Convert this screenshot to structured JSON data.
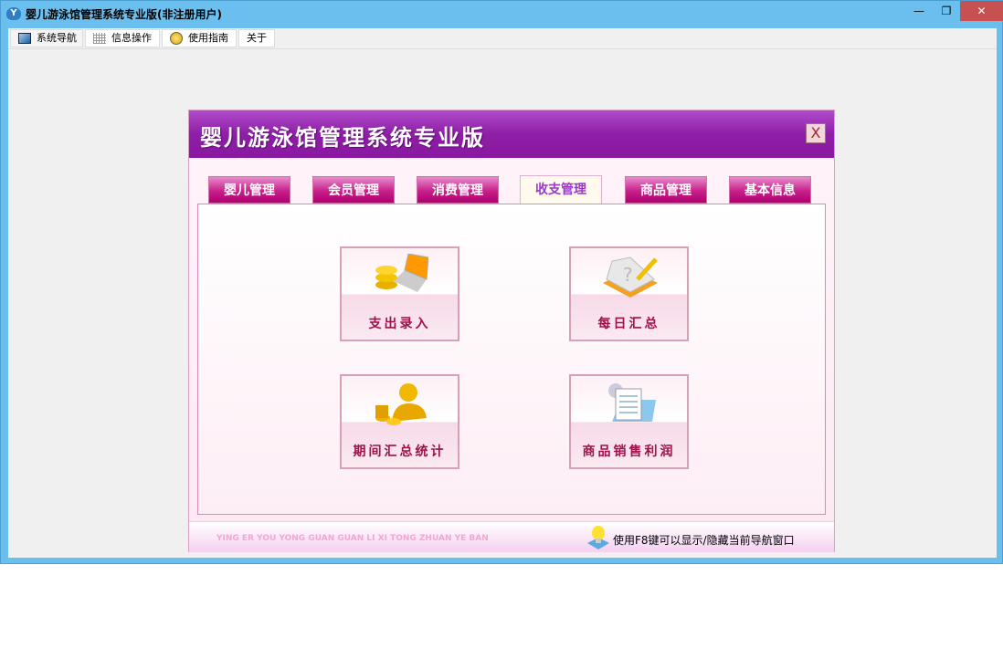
{
  "window": {
    "title": "婴儿游泳馆管理系统专业版(非注册用户)",
    "minimize": "—",
    "restore": "❐",
    "close": "✕"
  },
  "menu": [
    {
      "label": "系统导航",
      "icon": "monitor-icon"
    },
    {
      "label": "信息操作",
      "icon": "grid-icon"
    },
    {
      "label": "使用指南",
      "icon": "help-icon"
    },
    {
      "label": "关于"
    }
  ],
  "dialog": {
    "title": "婴儿游泳馆管理系统专业版",
    "close": "X",
    "tabs": [
      "婴儿管理",
      "会员管理",
      "消费管理",
      "收支管理",
      "商品管理",
      "基本信息"
    ],
    "active_tab": "收支管理",
    "buttons": [
      {
        "label": "支出录入",
        "icon": "coins-laptop-icon"
      },
      {
        "label": "每日汇总",
        "icon": "notebook-pencil-icon"
      },
      {
        "label": "期间汇总统计",
        "icon": "user-coins-icon"
      },
      {
        "label": "商品销售利润",
        "icon": "document-folder-icon"
      }
    ],
    "footer_pinyin": "YING ER YOU YONG GUAN GUAN LI XI TONG ZHUAN YE BAN",
    "footer_hint": "使用F8键可以显示/隐藏当前导航窗口"
  }
}
